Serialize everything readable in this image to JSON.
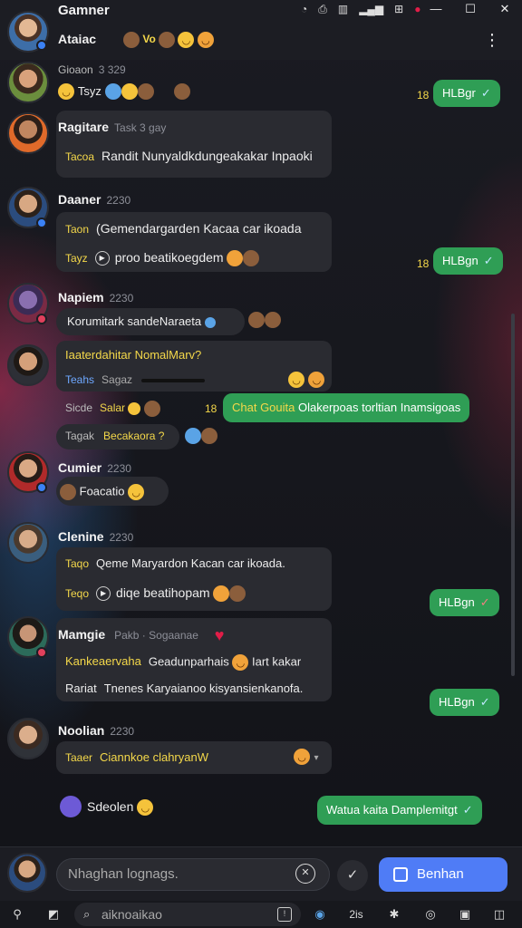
{
  "window": {
    "title": "Gamner",
    "controls": [
      "—",
      "☐",
      "✕"
    ],
    "status_icons": [
      "◔",
      "⎙",
      "▥",
      "⊞",
      "●"
    ]
  },
  "header": {
    "name": "Ataiac",
    "tag": "Vo"
  },
  "messages": [
    {
      "name": "Gioaon",
      "time": "3 329",
      "line1_label": "Tsyz",
      "line1_text": ""
    },
    {
      "name": "Ragitare",
      "time": "Task 3 gay",
      "line1_label": "Tacoa",
      "line1_text": "Randit Nunyaldkdungeakakar Inpaoki"
    },
    {
      "name": "Daaner",
      "time": "2230",
      "line1_label": "Taon",
      "line1_text": "(Gemendargarden Kacaa car ikoada",
      "line2_label": "Tayz",
      "line2_text": "proo beatikoegdem"
    },
    {
      "name": "Napiem",
      "time": "2230",
      "line1_label": "",
      "line1_text": "Korumitark sandeNaraeta"
    },
    {
      "name": "",
      "time": "",
      "line1_label": "",
      "line1_text": "Iaaterdahitar NomalMarv?",
      "line2_label": "Teahs",
      "line2_text": "Sagaz",
      "line3_label": "Sicde",
      "line3_text": "Salar",
      "line4_label": "Tagak",
      "line4_text": "Becakaora ?"
    },
    {
      "name": "Cumier",
      "time": "2230",
      "line1_label": "",
      "line1_text": "Foacatio"
    },
    {
      "name": "Clenine",
      "time": "2230",
      "line1_label": "Taqo",
      "line1_text": "Qeme Maryardon Kacan car ikoada.",
      "line2_label": "Teqo",
      "line2_text": "diqe beatihopam"
    },
    {
      "name": "Mamgie",
      "time": "Pakb · Sogaanae",
      "line1_label": "Kankeaervaha",
      "line1_text": "Geadunparhais",
      "line1_tail": "Iart kakar",
      "line2_label": "Rariat",
      "line2_text": "Tnenes Karyaianoo kisyansienkanofa."
    },
    {
      "name": "Noolian",
      "time": "2230",
      "line1_label": "Taaer",
      "line1_text": "Ciannkoe clahryanW"
    },
    {
      "name": "",
      "time": "",
      "line1_label": "",
      "line1_text": "Sdeolen"
    }
  ],
  "outgoing": [
    {
      "num": "18",
      "text": "HLBgr"
    },
    {
      "num": "18",
      "text": "HLBgn"
    },
    {
      "num": "18",
      "text": "Chat Gouita Olakerpoas torltian Inamsigoas"
    },
    {
      "num": "",
      "text": "HLBgn"
    },
    {
      "num": "",
      "text": "HLBgn"
    },
    {
      "num": "",
      "text": "Watua kaita Damplemitgt"
    }
  ],
  "composer": {
    "placeholder": "Nhaghan lognags.",
    "send_label": "Benhan"
  },
  "bottombar": {
    "search_placeholder": "aiknoaikao",
    "zoom": "2is"
  },
  "colors": {
    "accent": "#4f7cf6",
    "outgoing": "#2f9e55",
    "label": "#f4d84a"
  }
}
